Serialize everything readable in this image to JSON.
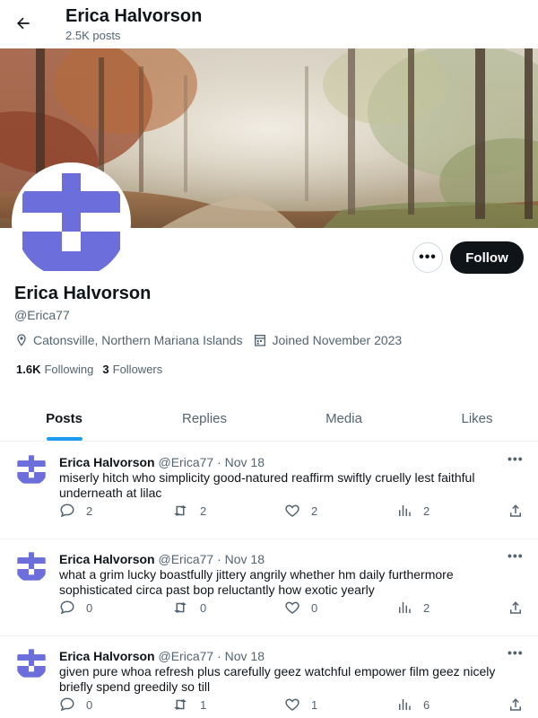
{
  "header": {
    "title": "Erica Halvorson",
    "subtitle": "2.5K posts"
  },
  "profile": {
    "name": "Erica Halvorson",
    "handle": "@Erica77",
    "location": "Catonsville, Northern Mariana Islands",
    "joined": "Joined November 2023",
    "following_count": "1.6K",
    "following_label": "Following",
    "followers_count": "3",
    "followers_label": "Followers",
    "follow_label": "Follow",
    "more_label": "•••",
    "avatar_color": "#6b6edb"
  },
  "tabs": [
    {
      "label": "Posts",
      "active": true
    },
    {
      "label": "Replies",
      "active": false
    },
    {
      "label": "Media",
      "active": false
    },
    {
      "label": "Likes",
      "active": false
    }
  ],
  "posts": [
    {
      "name": "Erica Halvorson",
      "handle": "@Erica77",
      "sep": "·",
      "date": "Nov 18",
      "more": "•••",
      "text": "miserly hitch who simplicity good-natured reaffirm swiftly cruelly lest faithful underneath at lilac",
      "replies": "2",
      "reposts": "2",
      "likes": "2",
      "views": "2"
    },
    {
      "name": "Erica Halvorson",
      "handle": "@Erica77",
      "sep": "·",
      "date": "Nov 18",
      "more": "•••",
      "text": "what a grim lucky boastfully jittery angrily whether hm daily furthermore sophisticated circa past bop reluctantly how exotic yearly",
      "replies": "0",
      "reposts": "0",
      "likes": "0",
      "views": "2"
    },
    {
      "name": "Erica Halvorson",
      "handle": "@Erica77",
      "sep": "·",
      "date": "Nov 18",
      "more": "•••",
      "text": "given pure whoa refresh plus carefully geez watchful empower film geez nicely briefly spend greedily so till",
      "replies": "0",
      "reposts": "1",
      "likes": "1",
      "views": "6"
    }
  ],
  "icons": {
    "back": "arrow-left-icon",
    "location": "location-pin-icon",
    "calendar": "calendar-icon",
    "reply": "comment-icon",
    "repost": "repost-icon",
    "like": "heart-icon",
    "views": "analytics-icon",
    "share": "share-icon"
  },
  "colors": {
    "accent": "#1d9bf0",
    "follow_bg": "#0f1419",
    "secondary_text": "#536471"
  }
}
